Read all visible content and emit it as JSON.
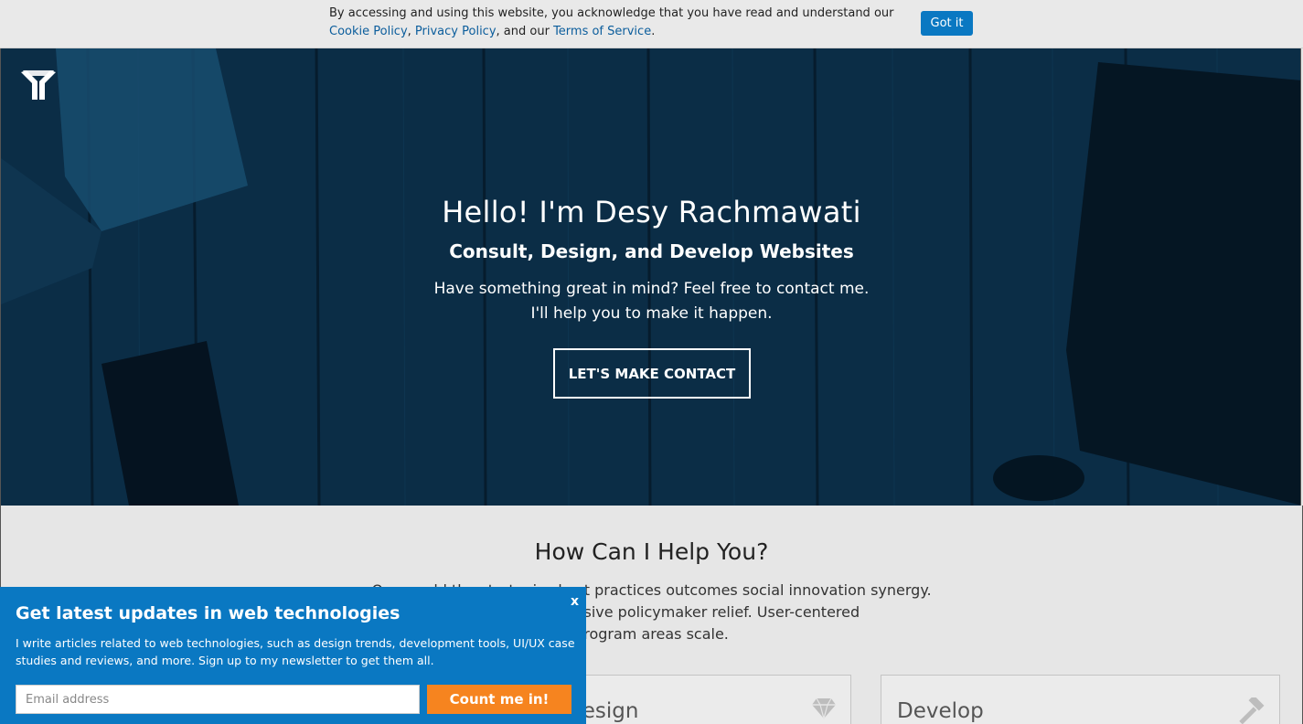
{
  "cookie": {
    "text": "By accessing and using this website, you acknowledge that you have read and understand our ",
    "cookie_policy": "Cookie Policy",
    "sep1": ", ",
    "privacy_policy": "Privacy Policy",
    "sep2": ", and our ",
    "terms": "Terms of Service",
    "end": ".",
    "button": "Got it"
  },
  "hero": {
    "title": "Hello! I'm Desy Rachmawati",
    "subtitle": "Consult, Design, and Develop Websites",
    "desc_line1": "Have something great in mind? Feel free to contact me.",
    "desc_line2": "I'll help you to make it happen.",
    "cta": "LET'S MAKE CONTACT"
  },
  "services": {
    "title": "How Can I Help You?",
    "desc_line1": "Overworld the strategize best practices outcomes social innovation synergy.",
    "desc_line2": "Revolutionary inclusive policymaker relief. User-centered",
    "desc_line3": "program areas scale.",
    "cards": [
      {
        "title": "Design",
        "icon": "diamond-icon"
      },
      {
        "title": "Develop",
        "icon": "hammer-icon"
      }
    ]
  },
  "newsletter": {
    "title": "Get latest updates in web technologies",
    "text": "I write articles related to web technologies, such as design trends, development tools, UI/UX case studies and reviews, and more. Sign up to my newsletter to get them all.",
    "close": "x",
    "placeholder": "Email address",
    "button": "Count me in!"
  },
  "colors": {
    "accent": "#0a78c2",
    "cta_orange": "#f6841f",
    "hero_bg": "#0c3350"
  }
}
